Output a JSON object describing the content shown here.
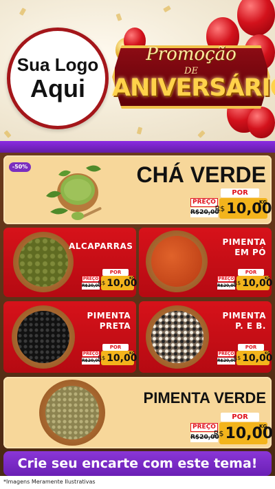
{
  "header": {
    "logo_line1": "Sua Logo",
    "logo_line2": "Aqui",
    "promo_text": "Promoção",
    "de_text": "DE",
    "aniversario_text": "ANIVERSÁRIO"
  },
  "featured_top": {
    "discount_badge": "-50%",
    "name": "CHÁ VERDE",
    "preco_label": "PREÇO",
    "por_label": "POR",
    "old_price": "R$20,00",
    "currency": "R$",
    "new_price": "10,00",
    "unit": "KG"
  },
  "products": [
    {
      "name_l1": "ALCAPARRAS",
      "name_l2": "",
      "preco_label": "PREÇO",
      "por_label": "POR",
      "old_price": "R$20,00",
      "currency": "R$",
      "new_price": "10,00",
      "unit": "KG"
    },
    {
      "name_l1": "PIMENTA",
      "name_l2": "EM PÓ",
      "preco_label": "PREÇO",
      "por_label": "POR",
      "old_price": "R$20,00",
      "currency": "R$",
      "new_price": "10,00",
      "unit": "KG"
    },
    {
      "name_l1": "PIMENTA",
      "name_l2": "PRETA",
      "preco_label": "PREÇO",
      "por_label": "POR",
      "old_price": "R$20,00",
      "currency": "R$",
      "new_price": "10,00",
      "unit": "KG"
    },
    {
      "name_l1": "PIMENTA",
      "name_l2": "P. E B.",
      "preco_label": "PREÇO",
      "por_label": "POR",
      "old_price": "R$20,00",
      "currency": "R$",
      "new_price": "10,00",
      "unit": "KG"
    }
  ],
  "featured_bottom": {
    "name": "PIMENTA VERDE",
    "preco_label": "PREÇO",
    "por_label": "POR",
    "old_price": "R$20,00",
    "currency": "R$",
    "new_price": "10,00",
    "unit": "KG"
  },
  "cta_text": "Crie seu encarte com este tema!",
  "footer_note": "*Imagens Meramente Ilustrativas",
  "colors": {
    "purple": "#7b2fbf",
    "red": "#d7121a",
    "cream": "#f7d79a",
    "gold": "#f3b41c"
  }
}
